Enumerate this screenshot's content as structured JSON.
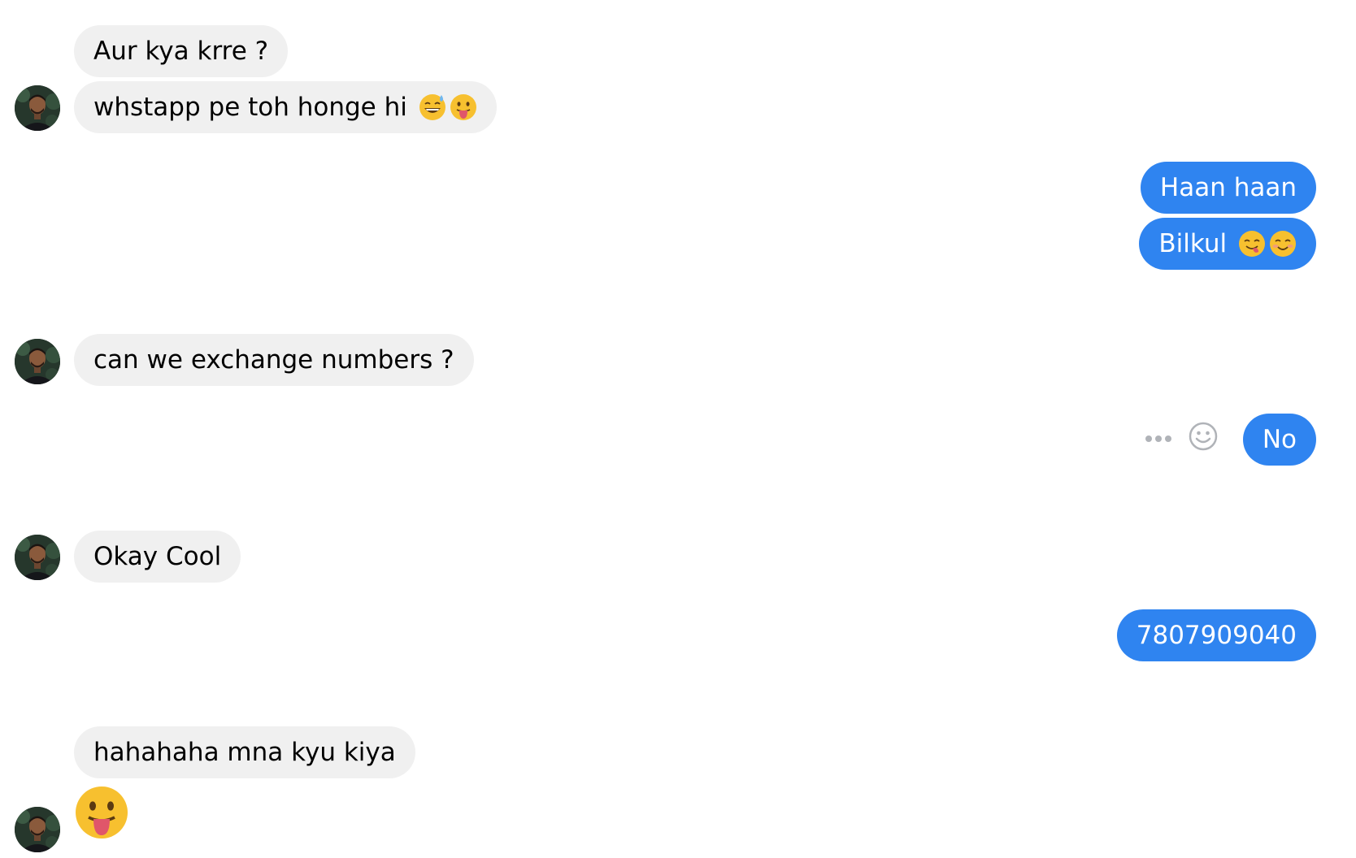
{
  "messages": [
    {
      "side": "in",
      "text": "Aur kya krre ?"
    },
    {
      "side": "in",
      "text": "whstapp pe toh honge hi",
      "emojis": [
        "grinning-sweat-emoji",
        "tongue-out-emoji"
      ]
    },
    {
      "side": "out",
      "text": "Haan haan"
    },
    {
      "side": "out",
      "text": "Bilkul",
      "emojis": [
        "yum-emoji",
        "blush-emoji"
      ]
    },
    {
      "side": "in",
      "text": "can we exchange numbers ?"
    },
    {
      "side": "out",
      "text": "No"
    },
    {
      "side": "in",
      "text": "Okay Cool"
    },
    {
      "side": "out",
      "text": "7807909040"
    },
    {
      "side": "in",
      "text": "hahahaha mna kyu kiya"
    },
    {
      "side": "in",
      "emoji_only": "tongue-out-emoji"
    }
  ],
  "message_actions": {
    "more_icon": "more-options-icon",
    "react_icon": "react-smiley-icon"
  },
  "colors": {
    "outgoing_bubble": "#2f84f0",
    "incoming_bubble": "#f0f0f0",
    "outgoing_text": "#ffffff",
    "incoming_text": "#000000",
    "action_icon": "#b0b3b8"
  }
}
